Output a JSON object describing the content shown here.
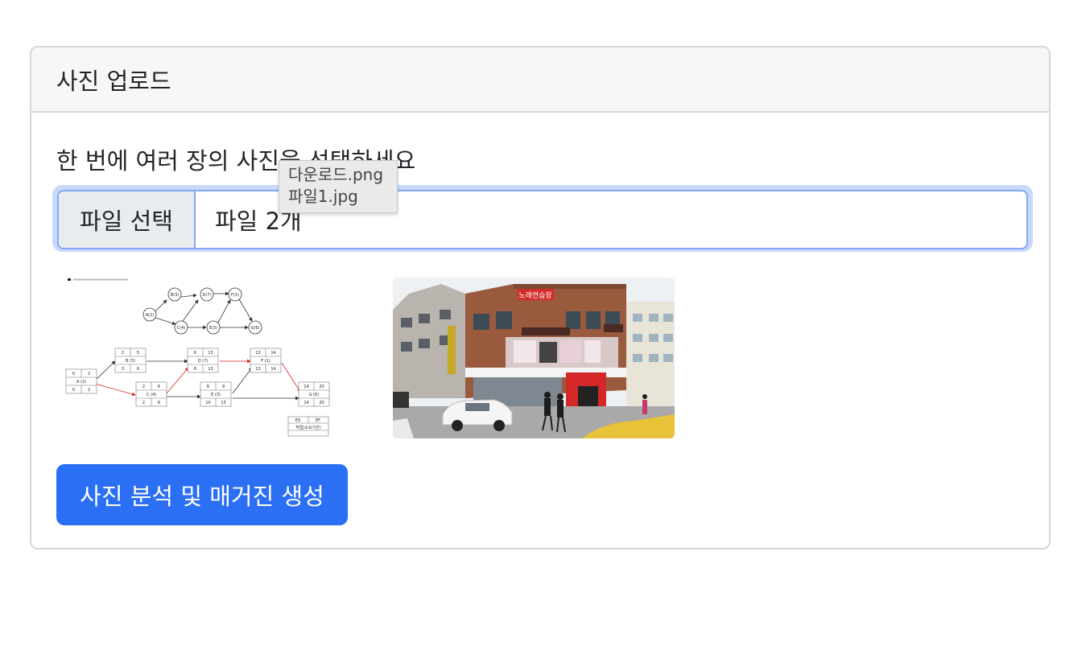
{
  "card": {
    "title": "사진 업로드",
    "instruction": "한 번에 여러 장의 사진을 선택하세요",
    "file_button_label": "파일 선택",
    "file_status": "파일 2개",
    "tooltip_files": [
      "다운로드.png",
      "파일1.jpg"
    ],
    "submit_label": "사진 분석 및 매거진 생성"
  },
  "diagram": {
    "top_nodes": [
      "A(2)",
      "B(3)",
      "C(4)",
      "D(7)",
      "E(3)",
      "F(1)",
      "G(6)"
    ],
    "boxes": [
      {
        "es": "0",
        "ef": "2",
        "name": "A (2)",
        "ls": "0",
        "lf": "2"
      },
      {
        "es": "2",
        "ef": "5",
        "name": "B (3)",
        "ls": "3",
        "lf": "6"
      },
      {
        "es": "2",
        "ef": "6",
        "name": "C (4)",
        "ls": "2",
        "lf": "6"
      },
      {
        "es": "6",
        "ef": "13",
        "name": "D (7)",
        "ls": "6",
        "lf": "13"
      },
      {
        "es": "6",
        "ef": "9",
        "name": "E (3)",
        "ls": "10",
        "lf": "13"
      },
      {
        "es": "13",
        "ef": "14",
        "name": "F (1)",
        "ls": "13",
        "lf": "14"
      },
      {
        "es": "14",
        "ef": "20",
        "name": "G (6)",
        "ls": "14",
        "lf": "20"
      }
    ],
    "legend": {
      "es": "ES",
      "ef": "EF",
      "name": "작업(소요기간)"
    }
  },
  "photo": {
    "sign_text": "노래연습장",
    "colors": {
      "brick": "#9a5a3e",
      "red_sign": "#d32a2a",
      "sky": "#e9eef2"
    }
  }
}
